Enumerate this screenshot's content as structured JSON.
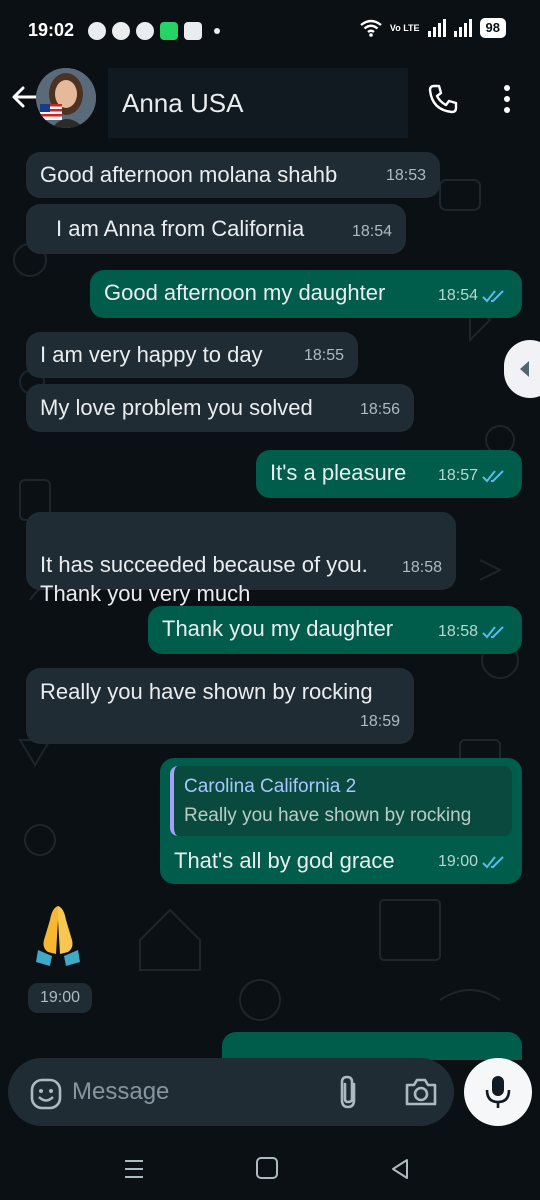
{
  "status_bar": {
    "time": "19:02",
    "network_label": "Vo LTE",
    "battery": "98",
    "icons": [
      "chat-bubble-icon",
      "whatsapp-icon",
      "whatsapp-icon",
      "app-icon",
      "photos-icon",
      "wifi-icon",
      "signal-icon",
      "signal-icon",
      "battery-icon"
    ]
  },
  "header": {
    "contact_name": "Anna USA",
    "icons": [
      "back-arrow-icon",
      "phone-icon",
      "more-vertical-icon"
    ]
  },
  "messages": [
    {
      "dir": "in",
      "text": "Good afternoon molana shahb",
      "time": "18:53"
    },
    {
      "dir": "in",
      "text": "I am Anna from California",
      "time": "18:54"
    },
    {
      "dir": "out",
      "text": "Good afternoon my daughter",
      "time": "18:54"
    },
    {
      "dir": "in",
      "text": "I am very happy to day",
      "time": "18:55"
    },
    {
      "dir": "in",
      "text": "My love problem you solved",
      "time": "18:56"
    },
    {
      "dir": "out",
      "text": "It's a pleasure",
      "time": "18:57"
    },
    {
      "dir": "in",
      "text": "It has succeeded because of you.\nThank you very much",
      "time": "18:58"
    },
    {
      "dir": "out",
      "text": "Thank you my daughter",
      "time": "18:58"
    },
    {
      "dir": "in",
      "text": "Really you have shown by rocking",
      "time": "18:59"
    },
    {
      "dir": "out",
      "text": "That's all by god grace",
      "time": "19:00",
      "quote": {
        "name": "Carolina California 2",
        "text": "Really you have shown by rocking"
      }
    }
  ],
  "emoji_message": {
    "emoji": "folded-hands",
    "time": "19:00"
  },
  "composer": {
    "placeholder": "Message",
    "icons": [
      "emoji-icon",
      "attach-icon",
      "camera-icon",
      "mic-icon"
    ]
  },
  "colors": {
    "background": "#0b1014",
    "incoming_bubble": "#1f2c34",
    "outgoing_bubble": "#005c4b",
    "read_tick": "#53bdeb",
    "accent_green": "#25d366"
  }
}
